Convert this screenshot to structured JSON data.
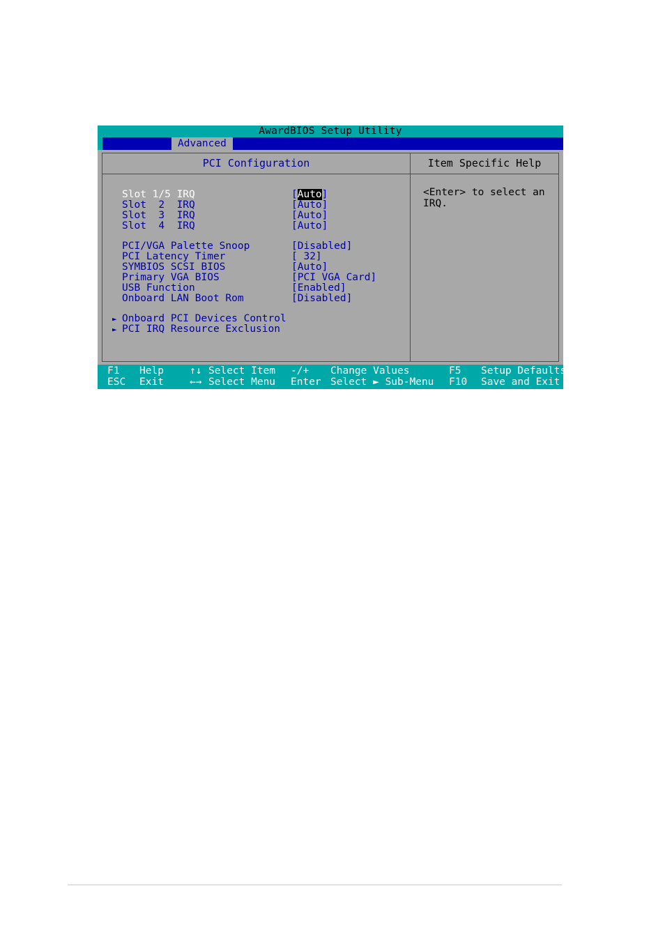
{
  "window": {
    "title": "AwardBIOS Setup Utility",
    "active_tab": "Advanced",
    "left_panel_title": "PCI Configuration",
    "right_panel_title": "Item Specific Help"
  },
  "colors": {
    "title_bar": "#00a8a8",
    "tab_bar": "#0000b4",
    "panel_bg": "#a8a8a8",
    "label": "#0000a8",
    "selected_label": "#ffffff",
    "highlight_bg": "#000000",
    "highlight_fg": "#ffffff",
    "legend_bar": "#00a8a8"
  },
  "settings": {
    "irq_group": [
      {
        "label": "Slot 1/5 IRQ",
        "value_prefix": "[",
        "value": "Auto",
        "value_suffix": "]",
        "selected": true
      },
      {
        "label": "Slot  2  IRQ",
        "value_prefix": "[",
        "value": "Auto",
        "value_suffix": "]",
        "selected": false
      },
      {
        "label": "Slot  3  IRQ",
        "value_prefix": "[",
        "value": "Auto",
        "value_suffix": "]",
        "selected": false
      },
      {
        "label": "Slot  4  IRQ",
        "value_prefix": "[",
        "value": "Auto",
        "value_suffix": "]",
        "selected": false
      }
    ],
    "options_group": [
      {
        "label": "PCI/VGA Palette Snoop",
        "value": "[Disabled]"
      },
      {
        "label": "PCI Latency Timer",
        "value": "[ 32]"
      },
      {
        "label": "SYMBIOS SCSI BIOS",
        "value": "[Auto]"
      },
      {
        "label": "Primary VGA BIOS",
        "value": "[PCI VGA Card]"
      },
      {
        "label": "USB Function",
        "value": "[Enabled]"
      },
      {
        "label": "Onboard LAN Boot Rom",
        "value": "[Disabled]"
      }
    ],
    "submenus": [
      {
        "arrow": "►",
        "label": "Onboard PCI Devices Control"
      },
      {
        "arrow": "►",
        "label": "PCI IRQ Resource Exclusion"
      }
    ]
  },
  "help": {
    "line1": "<Enter> to select an",
    "line2": "IRQ."
  },
  "legend": {
    "row1": [
      {
        "key": "F1",
        "desc": "Help"
      },
      {
        "key": "↑↓",
        "desc": "Select Item"
      },
      {
        "key": "-/+",
        "desc": "Change Values"
      },
      {
        "key": "F5",
        "desc": "Setup Defaults"
      }
    ],
    "row2": [
      {
        "key": "ESC",
        "desc": "Exit"
      },
      {
        "key": "←→",
        "desc": "Select Menu"
      },
      {
        "key": "Enter",
        "desc": "Select ► Sub-Menu"
      },
      {
        "key": "F10",
        "desc": "Save and Exit"
      }
    ]
  }
}
